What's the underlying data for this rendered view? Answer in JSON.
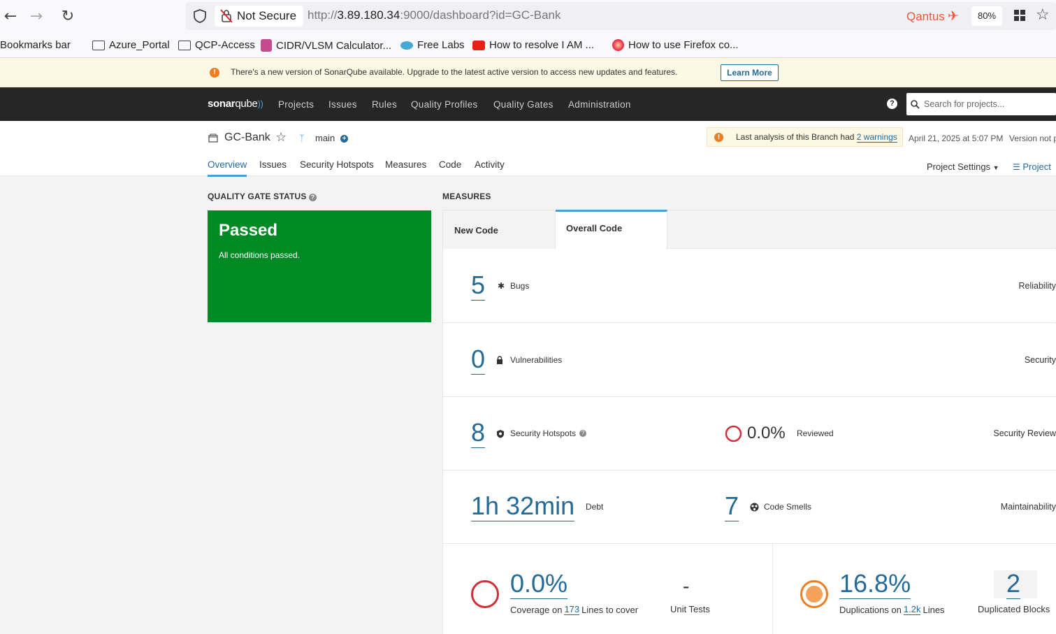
{
  "browser": {
    "not_secure_label": "Not Secure",
    "url_prefix": "http://",
    "url_host": "3.89.180.34",
    "url_rest": ":9000/dashboard?id=GC-Bank",
    "extension_label": "Qantus",
    "zoom": "80%",
    "bookmarks": [
      "Bookmarks bar",
      "Azure_Portal",
      "QCP-Access",
      "CIDR/VLSM Calculator...",
      "Free Labs",
      "How to resolve I AM ...",
      "How to use Firefox co..."
    ]
  },
  "banner": {
    "text": "There's a new version of SonarQube available. Upgrade to the latest active version to access new updates and features.",
    "button": "Learn More"
  },
  "nav": {
    "logo_a": "sonar",
    "logo_b": "qube",
    "items": [
      "Projects",
      "Issues",
      "Rules",
      "Quality Profiles",
      "Quality Gates",
      "Administration"
    ],
    "help": "?",
    "search_placeholder": "Search for projects..."
  },
  "project": {
    "name": "GC-Bank",
    "branch": "main",
    "warning_prefix": "Last analysis of this Branch had ",
    "warning_link": "2 warnings",
    "date": "April 21, 2025 at 5:07 PM",
    "version": "Version not p",
    "tabs": [
      "Overview",
      "Issues",
      "Security Hotspots",
      "Measures",
      "Code",
      "Activity"
    ],
    "settings": "Project Settings",
    "info": "Project"
  },
  "quality_gate": {
    "title": "QUALITY GATE STATUS",
    "status": "Passed",
    "message": "All conditions passed."
  },
  "measures": {
    "title": "MEASURES",
    "tab_new": "New Code",
    "tab_overall": "Overall Code",
    "bugs": {
      "value": "5",
      "label": "Bugs",
      "rating": "Reliability"
    },
    "vulns": {
      "value": "0",
      "label": "Vulnerabilities",
      "rating": "Security"
    },
    "hotspots": {
      "value": "8",
      "label": "Security Hotspots",
      "reviewed_value": "0.0%",
      "reviewed_label": "Reviewed",
      "rating": "Security Review"
    },
    "debt": {
      "value": "1h 32min",
      "label": "Debt",
      "smells_value": "7",
      "smells_label": "Code Smells",
      "rating": "Maintainability"
    },
    "coverage": {
      "value": "0.0%",
      "label_a": "Coverage on ",
      "lines": "173",
      "label_b": " Lines to cover",
      "unit_tests_value": "-",
      "unit_tests_label": "Unit Tests"
    },
    "duplications": {
      "value": "16.8%",
      "label_a": "Duplications on ",
      "lines": "1.2k",
      "label_b": " Lines",
      "blocks_value": "2",
      "blocks_label": "Duplicated Blocks"
    }
  },
  "colors": {
    "passed": "#008a25",
    "link": "#236a97",
    "error": "#d02f3a",
    "warn": "#ed7d20"
  }
}
